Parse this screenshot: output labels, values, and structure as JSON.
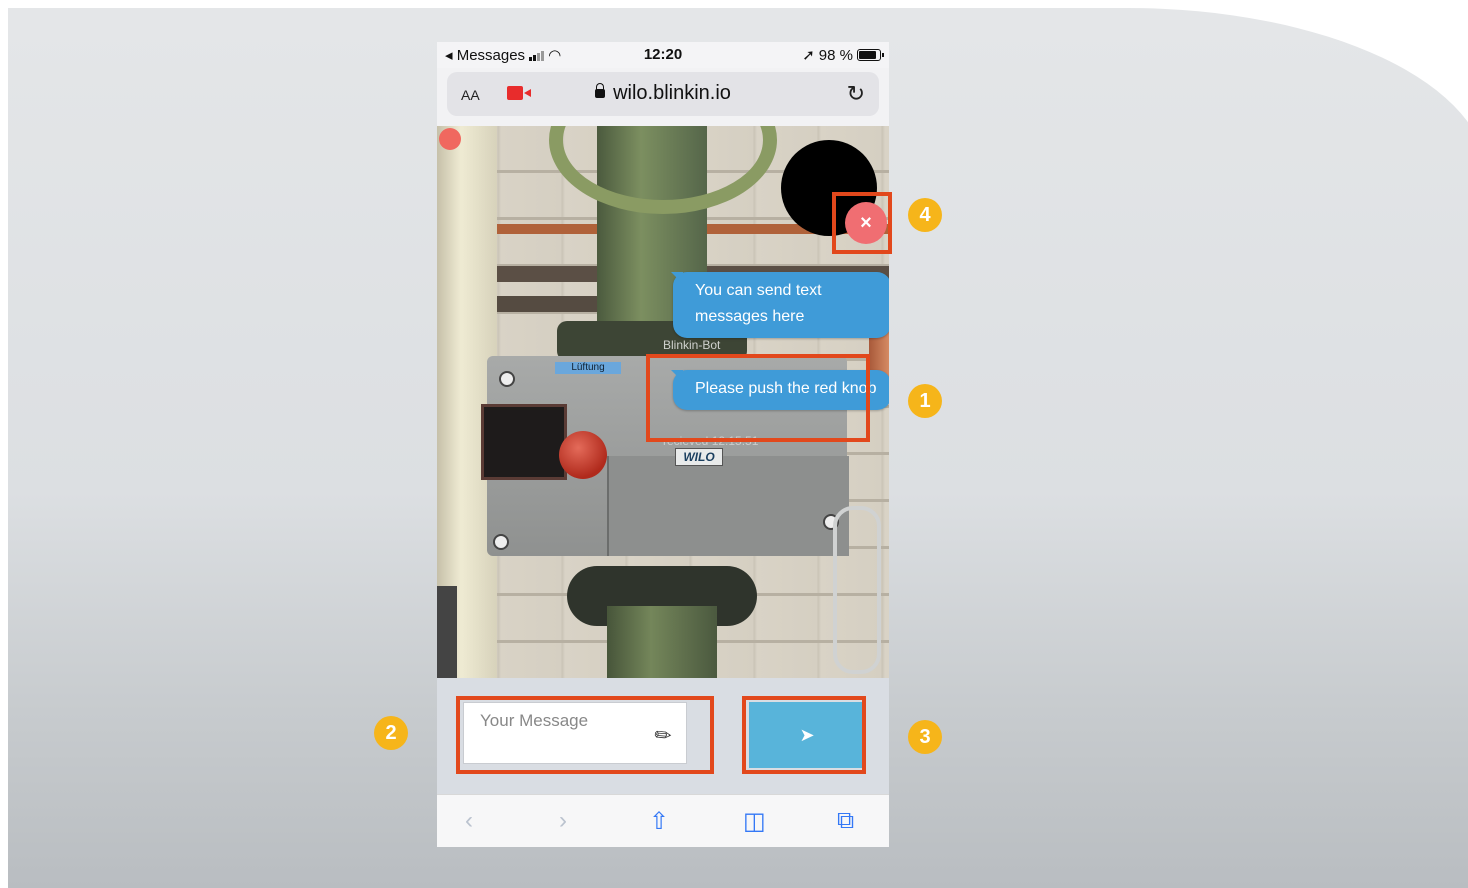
{
  "status_bar": {
    "back_app": "◂ Messages",
    "time": "12:20",
    "battery": "98 %"
  },
  "address_bar": {
    "text_size": "AA",
    "url": "wilo.blinkin.io"
  },
  "camera": {
    "label_plate": "Lüftung",
    "brand_plate": "WILO"
  },
  "chat": {
    "messages": [
      {
        "text": "You can send text messages here",
        "meta": "Blinkin-Bot"
      },
      {
        "text": "Please push the red knob",
        "meta": "recieved 12:15:51"
      }
    ],
    "close_label": "×"
  },
  "composer": {
    "placeholder": "Your Message",
    "send_icon": "paper-plane-icon"
  },
  "toolbar": {
    "icons": [
      "back-icon",
      "forward-icon",
      "share-icon",
      "bookmarks-icon",
      "tabs-icon"
    ]
  },
  "annotations": {
    "badges": [
      "1",
      "2",
      "3",
      "4"
    ],
    "accent_color": "#e2481c",
    "badge_color": "#f6b51a"
  }
}
